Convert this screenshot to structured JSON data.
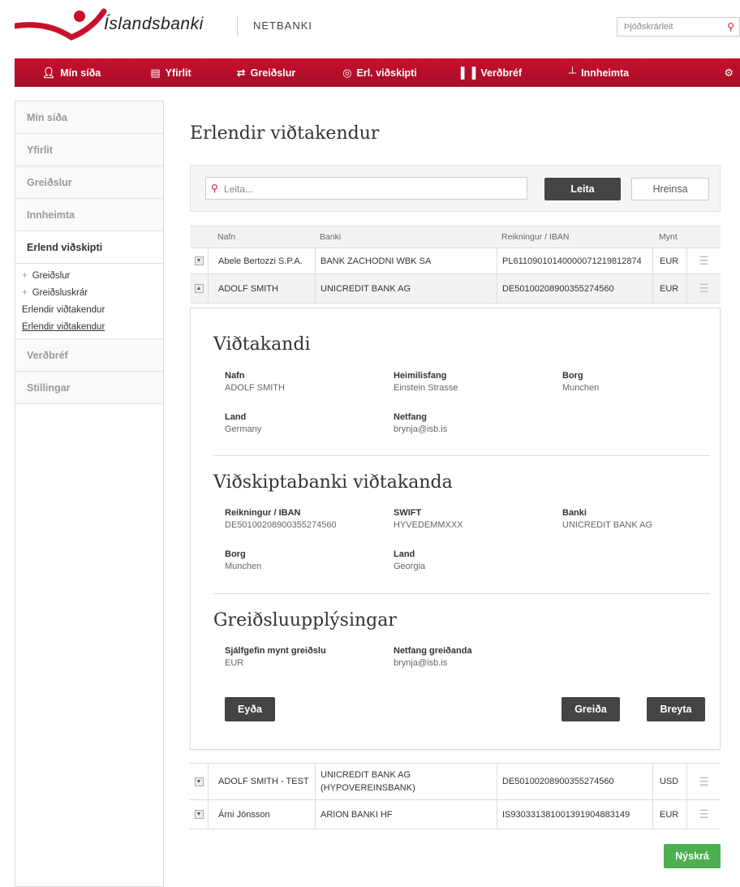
{
  "brand": {
    "name": "Íslandsbanki",
    "product": "NETBANKI",
    "accent": "#c8102e"
  },
  "top_search": {
    "placeholder": "Þjóðskrárleit"
  },
  "nav": [
    {
      "label": "Mín síða",
      "icon": "user-icon"
    },
    {
      "label": "Yfirlit",
      "icon": "document-icon"
    },
    {
      "label": "Greiðslur",
      "icon": "transfer-arrows-icon"
    },
    {
      "label": "Erl. viðskipti",
      "icon": "globe-icon"
    },
    {
      "label": "Verðbréf",
      "icon": "bar-chart-icon"
    },
    {
      "label": "Innheimta",
      "icon": "stamp-icon"
    },
    {
      "label": "",
      "icon": "gear-icon"
    }
  ],
  "sidebar": {
    "items": [
      "Mín síða",
      "Yfirlit",
      "Greiðslur",
      "Innheimta",
      "Erlend viðskipti",
      "Verðbréf",
      "Stillingar"
    ],
    "sub": [
      "Greiðslur",
      "Greiðsluskrár",
      "Erlendir viðtakendur",
      "Erlendir viðtakendur"
    ]
  },
  "page": {
    "title": "Erlendir viðtakendur"
  },
  "search": {
    "placeholder": "Leita...",
    "search_label": "Leita",
    "clear_label": "Hreinsa"
  },
  "table": {
    "headers": [
      "Nafn",
      "Banki",
      "Reikningur / IBAN",
      "Mynt"
    ],
    "rows": [
      {
        "name": "Abele Bertozzi S.P.A.",
        "bank": "BANK ZACHODNI WBK SA",
        "iban": "PL61109010140000071219812874",
        "currency": "EUR"
      },
      {
        "name": "ADOLF SMITH",
        "bank": "UNICREDIT BANK AG",
        "iban": "DE50100208900355274560",
        "currency": "EUR"
      },
      {
        "name": "ADOLF SMITH - TEST",
        "bank": "UNICREDIT BANK AG (HYPOVEREINSBANK)",
        "iban": "DE50100208900355274560",
        "currency": "USD"
      },
      {
        "name": "Árni Jónsson",
        "bank": "ARION BANKI HF",
        "iban": "IS930331381001391904883149",
        "currency": "EUR"
      }
    ]
  },
  "detail": {
    "recipient": {
      "heading": "Viðtakandi",
      "name_label": "Nafn",
      "name": "ADOLF SMITH",
      "address_label": "Heimilisfang",
      "address": "Einstein Strasse",
      "city_label": "Borg",
      "city": "Munchen",
      "country_label": "Land",
      "country": "Germany",
      "email_label": "Netfang",
      "email": "brynja@isb.is"
    },
    "bank": {
      "heading": "Viðskiptabanki viðtakanda",
      "iban_label": "Reikningur / IBAN",
      "iban": "DE50100208900355274560",
      "swift_label": "SWIFT",
      "swift": "HYVEDEMMXXX",
      "bank_label": "Banki",
      "bank": "UNICREDIT BANK AG",
      "city_label": "Borg",
      "city": "Munchen",
      "country_label": "Land",
      "country": "Georgia"
    },
    "payment": {
      "heading": "Greiðsluupplýsingar",
      "currency_label": "Sjálfgefin mynt greiðslu",
      "currency": "EUR",
      "email_label": "Netfang greiðanda",
      "email": "brynja@isb.is"
    },
    "delete_label": "Eyða",
    "pay_label": "Greiða",
    "edit_label": "Breyta"
  },
  "register_label": "Nýskrá"
}
